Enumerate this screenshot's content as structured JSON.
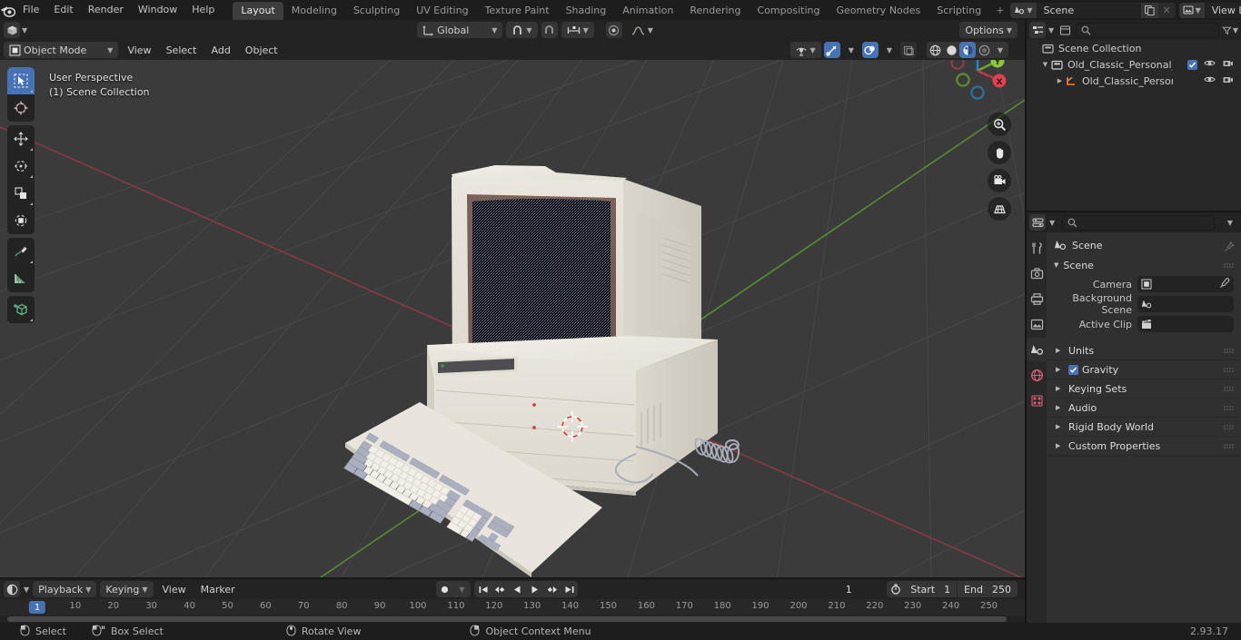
{
  "app": {
    "version": "2.93.17"
  },
  "topbar": {
    "logo_icon": "blender-logo-icon",
    "menus": [
      "File",
      "Edit",
      "Render",
      "Window",
      "Help"
    ],
    "workspaces": [
      "Layout",
      "Modeling",
      "Sculpting",
      "UV Editing",
      "Texture Paint",
      "Shading",
      "Animation",
      "Rendering",
      "Compositing",
      "Geometry Nodes",
      "Scripting"
    ],
    "active_workspace": "Layout",
    "add_workspace_label": "+",
    "scene": {
      "icon": "scene-icon",
      "name": "Scene",
      "copy_label": "duplicate-scene-icon",
      "delete_label": "x"
    },
    "view_layer": {
      "icon": "view-layer-icon",
      "name": "View Layer",
      "copy_label": "duplicate-layer-icon",
      "delete_label": "x"
    }
  },
  "viewport": {
    "header": {
      "editor_type_icon": "editor-type-3dview-icon",
      "mode": "Object Mode",
      "menus": [
        "View",
        "Select",
        "Add",
        "Object"
      ],
      "transform_orientation": "Global",
      "snap_icon": "magnet-icon",
      "proportional_icon": "proportional-edit-icon",
      "options_label": "Options"
    },
    "shading_modes": [
      "wireframe",
      "solid",
      "material-preview",
      "rendered"
    ],
    "active_shading": "material-preview",
    "overlay_text": {
      "perspective": "User Perspective",
      "collection": "(1) Scene Collection"
    },
    "toolbar": [
      {
        "name": "tweak-select-tool",
        "icon": "cursor-box-select-icon",
        "active": true
      },
      {
        "name": "cursor-tool",
        "icon": "3d-cursor-icon",
        "active": false
      },
      {
        "name": "move-tool",
        "icon": "move-arrows-icon",
        "active": false
      },
      {
        "name": "rotate-tool",
        "icon": "rotate-icon",
        "active": false
      },
      {
        "name": "scale-tool",
        "icon": "scale-icon",
        "active": false
      },
      {
        "name": "transform-tool",
        "icon": "transform-icon",
        "active": false
      },
      {
        "name": "annotate-tool",
        "icon": "pencil-icon",
        "active": false
      },
      {
        "name": "measure-tool",
        "icon": "ruler-icon",
        "active": false
      },
      {
        "name": "add-cube-tool",
        "icon": "add-cube-icon",
        "active": false
      }
    ],
    "gizmo": {
      "axes": [
        "Z",
        "Y",
        "X"
      ]
    },
    "nav_tools": [
      "zoom-icon",
      "pan-hand-icon",
      "camera-view-icon",
      "perspective-toggle-icon"
    ]
  },
  "outliner": {
    "display_mode_icon": "outliner-icon",
    "filter_icon": "filter-icon",
    "search_placeholder": "",
    "rows": [
      {
        "indent": 0,
        "triangle": "",
        "icon": "scene-collection-icon",
        "label": "Scene Collection",
        "has_checkbox": false,
        "show_eye": false,
        "show_camera": false
      },
      {
        "indent": 1,
        "triangle": "▼",
        "icon": "collection-icon",
        "label": "Old_Classic_Personal_Desktop",
        "has_checkbox": true,
        "show_eye": true,
        "show_camera": true
      },
      {
        "indent": 2,
        "triangle": "▶",
        "icon": "mesh-object-icon",
        "label": "Old_Classic_Personal_De",
        "has_checkbox": false,
        "show_eye": true,
        "show_camera": true
      }
    ]
  },
  "properties": {
    "editor_icon": "properties-editor-icon",
    "search_placeholder": "",
    "tabs": [
      {
        "name": "tool",
        "icon": "tool-icon",
        "active": false
      },
      {
        "name": "render",
        "icon": "render-camera-icon",
        "active": false
      },
      {
        "name": "output",
        "icon": "output-printer-icon",
        "active": false
      },
      {
        "name": "view-layer",
        "icon": "view-layer-images-icon",
        "active": false
      },
      {
        "name": "scene",
        "icon": "scene-cone-icon",
        "active": true
      },
      {
        "name": "world",
        "icon": "world-globe-icon",
        "active": false
      },
      {
        "name": "texture",
        "icon": "texture-checker-icon",
        "active": false
      }
    ],
    "breadcrumb": {
      "icon": "scene-cone-icon",
      "label": "Scene",
      "pin_icon": "pin-icon"
    },
    "scene_panel": {
      "title": "Scene",
      "rows": [
        {
          "label": "Camera",
          "value": "",
          "field_icon": "camera-object-icon",
          "has_eyedropper": true
        },
        {
          "label": "Background Scene",
          "value": "",
          "field_icon": "scene-cone-icon",
          "has_eyedropper": false
        },
        {
          "label": "Active Clip",
          "value": "",
          "field_icon": "movie-clip-icon",
          "has_eyedropper": false
        }
      ]
    },
    "closed_panels": [
      {
        "label": "Units",
        "checkbox": false
      },
      {
        "label": "Gravity",
        "checkbox": true
      },
      {
        "label": "Keying Sets",
        "checkbox": false
      },
      {
        "label": "Audio",
        "checkbox": false
      },
      {
        "label": "Rigid Body World",
        "checkbox": false
      },
      {
        "label": "Custom Properties",
        "checkbox": false
      }
    ]
  },
  "timeline": {
    "editor_icon": "timeline-editor-icon",
    "menus": [
      "Playback",
      "Keying",
      "View",
      "Marker"
    ],
    "record_icon": "auto-keying-record-icon",
    "transport": [
      "jump-start-icon",
      "prev-keyframe-icon",
      "play-reverse-icon",
      "play-icon",
      "next-keyframe-icon",
      "jump-end-icon"
    ],
    "current_frame": "1",
    "timer_icon": "use-preview-range-icon",
    "start_label": "Start",
    "start_value": "1",
    "end_label": "End",
    "end_value": "250",
    "ticks": [
      "10",
      "20",
      "30",
      "40",
      "50",
      "60",
      "70",
      "80",
      "90",
      "100",
      "110",
      "120",
      "130",
      "140",
      "150",
      "160",
      "170",
      "180",
      "190",
      "200",
      "210",
      "220",
      "230",
      "240",
      "250"
    ],
    "playhead_label": "1"
  },
  "statusbar": {
    "items": [
      {
        "icon": "mouse-left-icon",
        "label": "Select"
      },
      {
        "icon": "mouse-left-drag-icon",
        "label": "Box Select"
      },
      {
        "icon": "mouse-middle-icon",
        "label": "Rotate View"
      },
      {
        "icon": "mouse-right-icon",
        "label": "Object Context Menu"
      }
    ],
    "version": "2.93.17"
  },
  "colors": {
    "accent": "#4772b3",
    "viewport_bg": "#3b3b3b",
    "panel_bg": "#303030",
    "header_bg": "#232323",
    "axis_x": "#a4404f",
    "axis_y": "#5d9a33",
    "case": "#e8e4dc"
  }
}
